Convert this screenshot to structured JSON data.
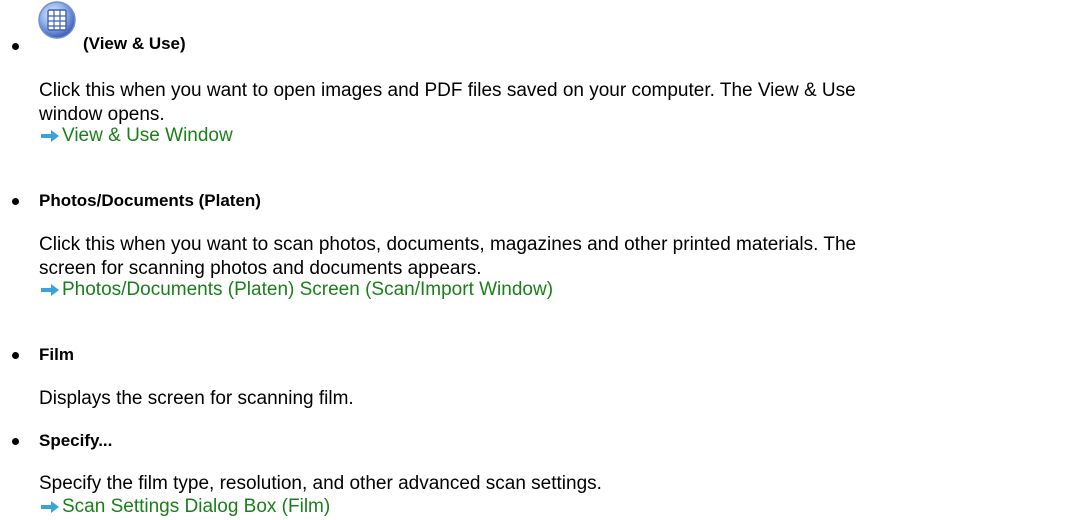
{
  "items": [
    {
      "heading": "(View & Use)",
      "icon": "view-and-use-icon",
      "lines": [
        "Click this when you want to open images and PDF files saved on your computer. The View & Use",
        "window opens."
      ],
      "link": "View & Use Window"
    },
    {
      "heading": "Photos/Documents (Platen)",
      "lines": [
        "Click this when you want to scan photos, documents, magazines and other printed materials. The",
        "screen for scanning photos and documents appears."
      ],
      "link": "Photos/Documents (Platen) Screen (Scan/Import Window)"
    },
    {
      "heading": "Film",
      "lines": [
        "Displays the screen for scanning film."
      ]
    },
    {
      "heading": "Specify...",
      "lines": [
        "Specify the film type, resolution, and other advanced scan settings."
      ],
      "link": "Scan Settings Dialog Box (Film)"
    }
  ],
  "colors": {
    "link": "#1a7f1a",
    "arrow": "#3aa3d8"
  }
}
